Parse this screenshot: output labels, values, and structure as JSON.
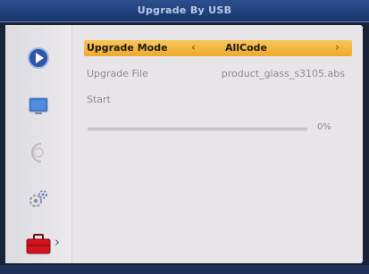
{
  "window": {
    "title": "Upgrade By USB"
  },
  "menu": {
    "upgrade_mode": {
      "label": "Upgrade Mode",
      "value": "AllCode"
    },
    "upgrade_file": {
      "label": "Upgrade File",
      "value": "product_glass_s3105.abs"
    },
    "start": {
      "label": "Start"
    }
  },
  "progress": {
    "percent": 0,
    "text": "0%"
  },
  "sidebar": {
    "icons": [
      "media-play-icon",
      "tv-monitor-icon",
      "globe-icon",
      "settings-gears-icon",
      "toolbox-icon"
    ],
    "selected_index": 4
  },
  "colors": {
    "highlight": "#eeaa2c",
    "arrow": "#c84f12",
    "title_bar": "#20407a"
  }
}
